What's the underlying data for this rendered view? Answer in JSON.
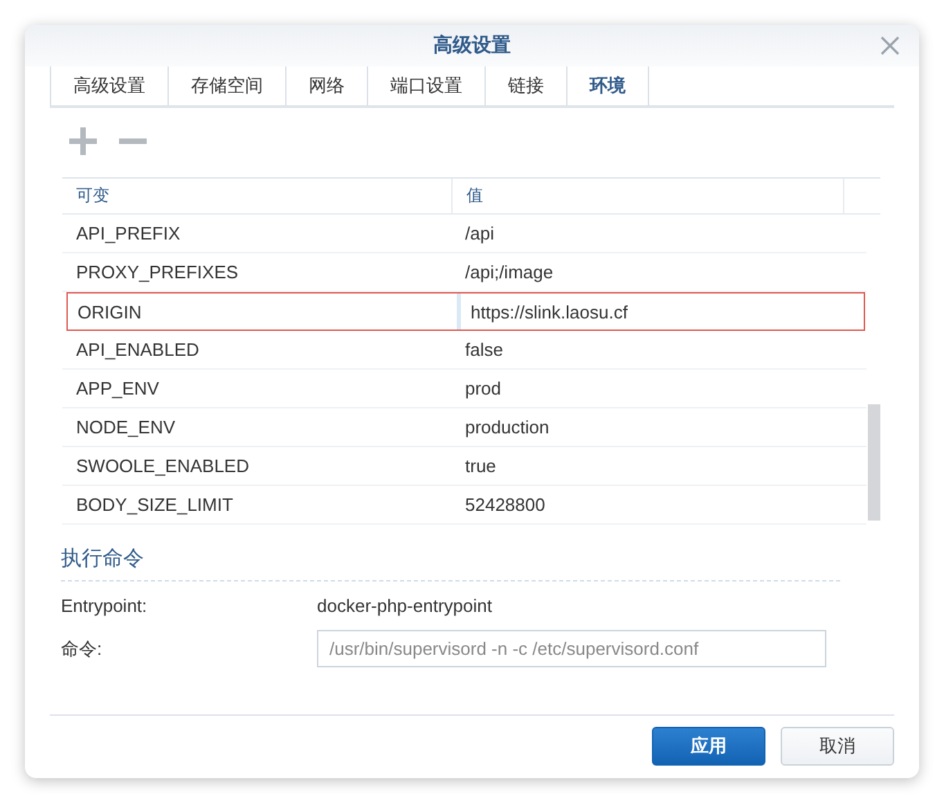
{
  "window": {
    "title": "高级设置"
  },
  "tabs": [
    {
      "label": "高级设置",
      "selected": false
    },
    {
      "label": "存储空间",
      "selected": false
    },
    {
      "label": "网络",
      "selected": false
    },
    {
      "label": "端口设置",
      "selected": false
    },
    {
      "label": "链接",
      "selected": false
    },
    {
      "label": "环境",
      "selected": true
    }
  ],
  "table": {
    "columns": [
      "可变",
      "值"
    ],
    "rows": [
      {
        "name": "API_PREFIX",
        "value": "/api",
        "selected": false
      },
      {
        "name": "PROXY_PREFIXES",
        "value": "/api;/image",
        "selected": false
      },
      {
        "name": "ORIGIN",
        "value": "https://slink.laosu.cf",
        "selected": true
      },
      {
        "name": "API_ENABLED",
        "value": "false",
        "selected": false
      },
      {
        "name": "APP_ENV",
        "value": "prod",
        "selected": false
      },
      {
        "name": "NODE_ENV",
        "value": "production",
        "selected": false
      },
      {
        "name": "SWOOLE_ENABLED",
        "value": "true",
        "selected": false
      },
      {
        "name": "BODY_SIZE_LIMIT",
        "value": "52428800",
        "selected": false
      }
    ]
  },
  "command_section": {
    "heading": "执行命令",
    "entrypoint_label": "Entrypoint:",
    "entrypoint_value": "docker-php-entrypoint",
    "command_label": "命令:",
    "command_value": "/usr/bin/supervisord -n -c /etc/supervisord.conf"
  },
  "buttons": [
    {
      "label": "应用",
      "kind": "primary"
    },
    {
      "label": "取消",
      "kind": "secondary"
    }
  ]
}
